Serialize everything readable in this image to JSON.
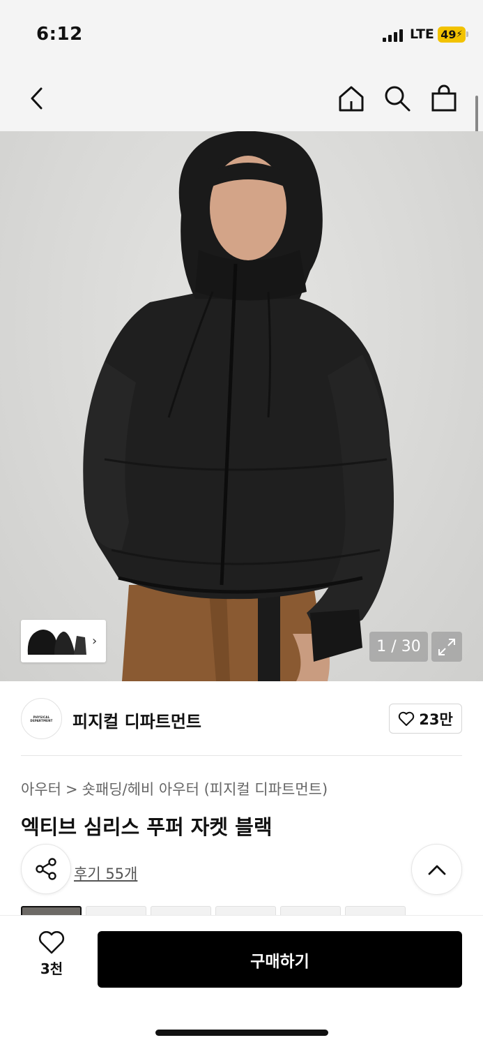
{
  "status_bar": {
    "time": "6:12",
    "network": "LTE",
    "battery": "49"
  },
  "nav": {
    "back_icon": "chevron-left-icon",
    "home_icon": "home-icon",
    "search_icon": "search-icon",
    "cart_icon": "shopping-bag-icon"
  },
  "gallery": {
    "counter": "1 / 30",
    "current": 1,
    "total": 30,
    "expand_icon": "expand-icon"
  },
  "brand": {
    "logo_text": "PHYSICAL DEPARTMENT",
    "name": "피지컬 디파트먼트",
    "likes": "23만"
  },
  "breadcrumb": {
    "category": "아우터",
    "separator": ">",
    "subcategory": "숏패딩/헤비 아우터 (피지컬 디파트먼트)"
  },
  "product": {
    "title": "엑티브 심리스 푸퍼 자켓 블랙",
    "reviews": "후기 55개"
  },
  "bottom": {
    "wish_count": "3천",
    "buy_label": "구매하기"
  },
  "colors": {
    "accent": "#000000",
    "battery": "#f2c200"
  }
}
